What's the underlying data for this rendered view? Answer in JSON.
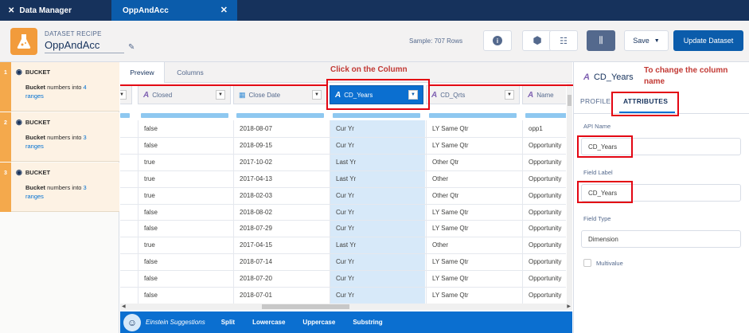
{
  "topbar": {
    "app_tab_label": "Data Manager",
    "active_tab_label": "OppAndAcc",
    "close_icon": "close-icon"
  },
  "header": {
    "recipe_label": "DATASET RECIPE",
    "recipe_name": "OppAndAcc",
    "sample_text": "Sample: 707 Rows",
    "save_label": "Save",
    "update_label": "Update Dataset"
  },
  "sidebar": {
    "nodes": [
      {
        "num": "1",
        "title": "BUCKET",
        "desc_bold": "Bucket",
        "desc_mid": " numbers into ",
        "count": "4",
        "desc_end": "ranges"
      },
      {
        "num": "2",
        "title": "BUCKET",
        "desc_bold": "Bucket",
        "desc_mid": " numbers into ",
        "count": "3",
        "desc_end": "ranges"
      },
      {
        "num": "3",
        "title": "BUCKET",
        "desc_bold": "Bucket",
        "desc_mid": " numbers into ",
        "count": "3",
        "desc_end": "ranges"
      }
    ]
  },
  "center": {
    "tabs": [
      "Preview",
      "Columns"
    ],
    "annotation": "Click on the Column",
    "columns": [
      {
        "label": "Closed",
        "type": "A"
      },
      {
        "label": "Close Date",
        "type": "cal"
      },
      {
        "label": "CD_Years",
        "type": "A"
      },
      {
        "label": "CD_Qrts",
        "type": "A"
      },
      {
        "label": "Name",
        "type": "A"
      }
    ],
    "rows": [
      [
        "false",
        "2018-08-07",
        "Cur Yr",
        "LY Same Qtr",
        "opp1"
      ],
      [
        "false",
        "2018-09-15",
        "Cur Yr",
        "LY Same Qtr",
        "Opportunity"
      ],
      [
        "true",
        "2017-10-02",
        "Last Yr",
        "Other Qtr",
        "Opportunity"
      ],
      [
        "true",
        "2017-04-13",
        "Last Yr",
        "Other",
        "Opportunity"
      ],
      [
        "true",
        "2018-02-03",
        "Cur Yr",
        "Other Qtr",
        "Opportunity"
      ],
      [
        "false",
        "2018-08-02",
        "Cur Yr",
        "LY Same Qtr",
        "Opportunity"
      ],
      [
        "false",
        "2018-07-29",
        "Cur Yr",
        "LY Same Qtr",
        "Opportunity"
      ],
      [
        "true",
        "2017-04-15",
        "Last Yr",
        "Other",
        "Opportunity"
      ],
      [
        "false",
        "2018-07-14",
        "Cur Yr",
        "LY Same Qtr",
        "Opportunity"
      ],
      [
        "false",
        "2018-07-20",
        "Cur Yr",
        "LY Same Qtr",
        "Opportunity"
      ],
      [
        "false",
        "2018-07-01",
        "Cur Yr",
        "LY Same Qtr",
        "Opportunity"
      ]
    ]
  },
  "suggestions": {
    "label": "Einstein Suggestions",
    "actions": [
      "Split",
      "Lowercase",
      "Uppercase",
      "Substring"
    ]
  },
  "right_panel": {
    "title": "CD_Years",
    "annotation": "To change the column name",
    "tab_profile": "PROFILE",
    "tab_attributes": "ATTRIBUTES",
    "api_name_label": "API Name",
    "api_name_value": "CD_Years",
    "field_label_label": "Field Label",
    "field_label_value": "CD_Years",
    "field_type_label": "Field Type",
    "field_type_value": "Dimension",
    "multivalue_label": "Multivalue"
  },
  "colors": {
    "brand_dark": "#16325c",
    "brand_blue": "#0b5cab",
    "annotation_red": "#e30613",
    "bucket_orange": "#f4a94c"
  }
}
